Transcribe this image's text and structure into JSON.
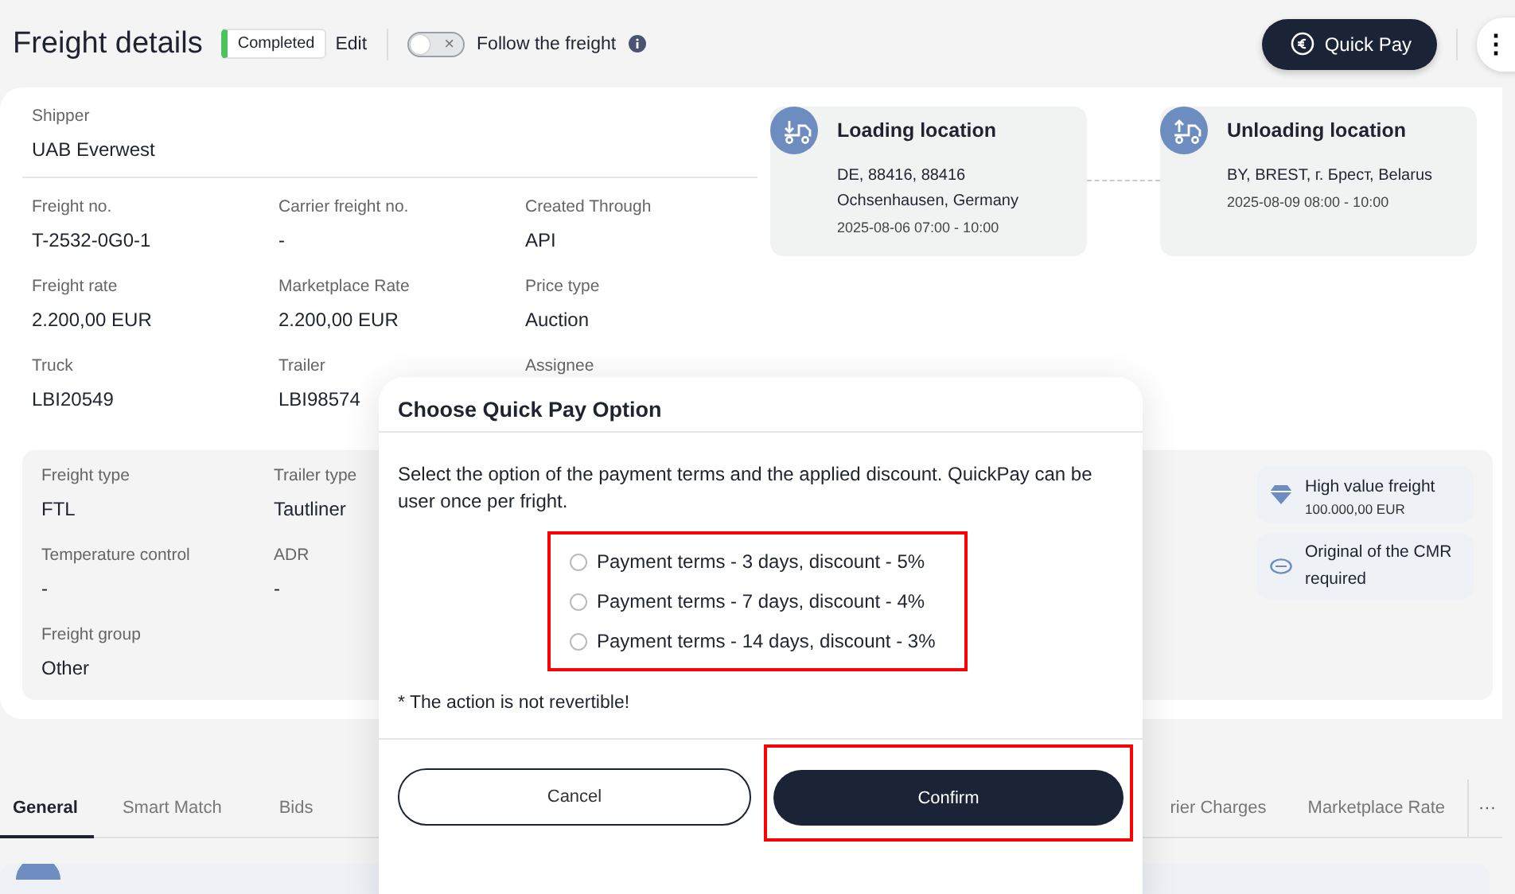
{
  "header": {
    "title": "Freight details",
    "status": "Completed",
    "edit": "Edit",
    "follow": {
      "label": "Follow the freight",
      "on": false,
      "off_glyph": "×"
    },
    "quick_pay": "Quick Pay",
    "more": "⋮"
  },
  "details": {
    "shipper": {
      "label": "Shipper",
      "value": "UAB Everwest"
    },
    "fields": [
      {
        "label": "Freight no.",
        "value": "T-2532-0G0-1"
      },
      {
        "label": "Carrier freight no.",
        "value": "-"
      },
      {
        "label": "Created Through",
        "value": "API"
      },
      {
        "label": "Freight rate",
        "value": "2.200,00 EUR"
      },
      {
        "label": "Marketplace Rate",
        "value": "2.200,00 EUR"
      },
      {
        "label": "Price type",
        "value": "Auction"
      },
      {
        "label": "Truck",
        "value": "LBI20549"
      },
      {
        "label": "Trailer",
        "value": "LBI98574"
      },
      {
        "label": "Assignee"
      }
    ]
  },
  "locations": [
    {
      "kind": "loading",
      "title": "Loading location",
      "lines": [
        "DE, 88416, 88416",
        "Ochsenhausen, Germany"
      ],
      "time": "2025-08-06 07:00 - 10:00"
    },
    {
      "kind": "unloading",
      "title": "Unloading location",
      "lines": [
        "BY, BREST, г. Брест, Belarus"
      ],
      "time": "2025-08-09 08:00 - 10:00"
    }
  ],
  "cargo": {
    "fields": [
      {
        "label": "Freight type",
        "value": "FTL"
      },
      {
        "label": "Trailer type",
        "value": "Tautliner"
      },
      {
        "label": "Temperature control",
        "value": "-"
      },
      {
        "label": "ADR",
        "value": "-"
      },
      {
        "label": "Freight group",
        "value": "Other"
      }
    ],
    "chips": [
      {
        "kind": "diamond",
        "title": "High value freight",
        "detail": "100.000,00 EUR"
      },
      {
        "kind": "cmr",
        "title": "Original of the CMR required"
      }
    ]
  },
  "tabs": [
    {
      "label": "General",
      "selected": true
    },
    {
      "label": "Smart Match",
      "selected": false
    },
    {
      "label": "Bids",
      "selected": false
    },
    {
      "label": "rier Charges",
      "selected": false
    },
    {
      "label": "Marketplace Rate",
      "selected": false
    }
  ],
  "tabs_more": "···",
  "dialog": {
    "title": "Choose Quick Pay Option",
    "text": "Select the option of the payment terms and the applied discount. QuickPay can be user once per fright.",
    "options": [
      {
        "label": "Payment terms - 3 days, discount - 5%",
        "selected": false
      },
      {
        "label": "Payment terms - 7 days, discount - 4%",
        "selected": false
      },
      {
        "label": "Payment terms - 14 days, discount - 3%",
        "selected": false
      }
    ],
    "options_highlighted": true,
    "note": "* The action is not revertible!",
    "cancel": "Cancel",
    "confirm": {
      "label": "Confirm",
      "highlighted": true
    }
  }
}
